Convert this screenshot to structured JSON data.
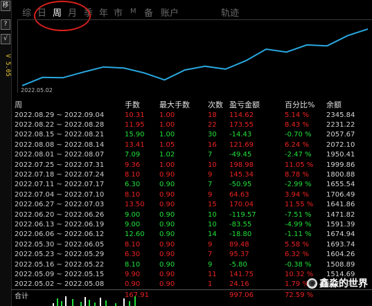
{
  "sidebar": {
    "buttons": [
      "移",
      "?",
      "√"
    ],
    "version": "V 5.05"
  },
  "tabs": [
    {
      "label": "综",
      "active": false
    },
    {
      "label": "日",
      "active": false
    },
    {
      "label": "周",
      "active": true
    },
    {
      "label": "月",
      "active": false
    },
    {
      "label": "季",
      "active": false
    },
    {
      "label": "年",
      "active": false
    },
    {
      "label": "市",
      "active": false
    },
    {
      "label": "M",
      "active": false
    },
    {
      "label": "备",
      "active": false
    },
    {
      "label": "账户",
      "active": false
    },
    {
      "label": "轨迹",
      "active": false
    }
  ],
  "chart": {
    "start_label": "2022.05.02",
    "line_color": "#29a8e0",
    "balance_series": [
      1372.94,
      1514.69,
      1508.89,
      1604.26,
      1693.74,
      1674.94,
      1591.39,
      1471.82,
      1641.86,
      1706.49,
      1655.54,
      1800.88,
      1999.86,
      1950.41,
      2072.1,
      2057.67,
      2231.22,
      2345.84
    ],
    "ylim": [
      1250,
      2500
    ]
  },
  "table": {
    "headers": [
      "周",
      "手数",
      "最大手数",
      "次数",
      "盈亏金额",
      "百分比%",
      "余额"
    ],
    "rows": [
      [
        "2022.08.29 ~ 2022.09.04",
        "10.31",
        "1.00",
        "18",
        "114.62",
        "5.14 %",
        "2345.84",
        "red"
      ],
      [
        "2022.08.22 ~ 2022.08.28",
        "11.95",
        "1.00",
        "22",
        "173.55",
        "8.43 %",
        "2231.22",
        "red"
      ],
      [
        "2022.08.15 ~ 2022.08.21",
        "15.90",
        "1.00",
        "30",
        "-14.43",
        "-0.70 %",
        "2057.67",
        "green"
      ],
      [
        "2022.08.08 ~ 2022.08.14",
        "13.41",
        "1.05",
        "16",
        "121.69",
        "6.24 %",
        "2072.10",
        "red"
      ],
      [
        "2022.08.01 ~ 2022.08.07",
        "7.09",
        "1.02",
        "7",
        "-49.45",
        "-2.47 %",
        "1950.41",
        "green"
      ],
      [
        "2022.07.25 ~ 2022.07.31",
        "9.36",
        "1.00",
        "10",
        "198.98",
        "11.05 %",
        "1999.86",
        "red"
      ],
      [
        "2022.07.18 ~ 2022.07.24",
        "8.10",
        "0.90",
        "9",
        "145.34",
        "8.78 %",
        "1800.88",
        "red"
      ],
      [
        "2022.07.11 ~ 2022.07.17",
        "6.30",
        "0.90",
        "7",
        "-50.95",
        "-2.99 %",
        "1655.54",
        "green"
      ],
      [
        "2022.07.04 ~ 2022.07.10",
        "8.10",
        "0.90",
        "9",
        "64.63",
        "3.94 %",
        "1706.49",
        "red"
      ],
      [
        "2022.06.27 ~ 2022.07.03",
        "13.50",
        "0.90",
        "15",
        "170.04",
        "11.55 %",
        "1641.86",
        "red"
      ],
      [
        "2022.06.20 ~ 2022.06.26",
        "9.00",
        "0.90",
        "10",
        "-119.57",
        "-7.51 %",
        "1471.82",
        "green"
      ],
      [
        "2022.06.13 ~ 2022.06.19",
        "9.00",
        "0.90",
        "10",
        "-83.55",
        "-4.99 %",
        "1591.39",
        "green"
      ],
      [
        "2022.06.06 ~ 2022.06.12",
        "12.60",
        "0.90",
        "14",
        "-18.80",
        "-1.11 %",
        "1674.94",
        "green"
      ],
      [
        "2022.05.30 ~ 2022.06.05",
        "8.10",
        "0.90",
        "9",
        "89.48",
        "5.58 %",
        "1693.74",
        "red"
      ],
      [
        "2022.05.23 ~ 2022.05.29",
        "6.30",
        "0.90",
        "7",
        "95.37",
        "6.32 %",
        "1604.26",
        "red"
      ],
      [
        "2022.05.16 ~ 2022.05.22",
        "8.10",
        "0.90",
        "9",
        "-5.80",
        "-0.38 %",
        "1508.89",
        "green"
      ],
      [
        "2022.05.09 ~ 2022.05.15",
        "9.90",
        "0.90",
        "11",
        "141.75",
        "10.32 %",
        "1514.69",
        "red"
      ],
      [
        "2022.05.02 ~ 2022.05.08",
        "0.90",
        "0.90",
        "1",
        "24.16",
        "1.79 %",
        "1372.94",
        "red"
      ]
    ],
    "summary": {
      "label": "合计",
      "lots": "167.91",
      "amount": "997.06",
      "percent": "72.59 %"
    }
  },
  "watermark": {
    "logo_glyph": "@",
    "text": "鑫淼的世界"
  }
}
